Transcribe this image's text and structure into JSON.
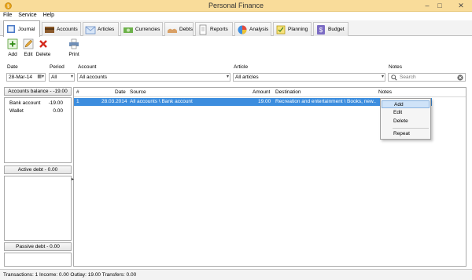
{
  "window": {
    "title": "Personal Finance",
    "minimize": "–",
    "maximize": "□",
    "close": "✕"
  },
  "menu": [
    "File",
    "Service",
    "Help"
  ],
  "tabs": [
    "Journal",
    "Accounts",
    "Articles",
    "Currencies",
    "Debts",
    "Reports",
    "Analysis",
    "Planning",
    "Budget"
  ],
  "toolbar": {
    "add": "Add",
    "edit": "Edit",
    "delete": "Delete",
    "print": "Print"
  },
  "filters": {
    "date_label": "Date",
    "date_value": "28-Mar-14",
    "period_label": "Period",
    "period_value": "All",
    "account_label": "Account",
    "account_value": "All accounts",
    "article_label": "Article",
    "article_value": "All articles",
    "notes_label": "Notes",
    "search_placeholder": "Search"
  },
  "left": {
    "accounts_balance": "Accounts balance  -  -19.00",
    "accounts": [
      {
        "name": "Bank account",
        "value": "-19.00"
      },
      {
        "name": "Wallet",
        "value": "0.00"
      }
    ],
    "active_debt": "Active debt  -  0.00",
    "passive_debt": "Passive debt  -  0.00"
  },
  "grid": {
    "columns": {
      "num": "#",
      "date": "Date",
      "source": "Source",
      "amount": "Amount",
      "destination": "Destination",
      "notes": "Notes"
    },
    "rows": [
      {
        "num": "1",
        "date": "28.03.2014",
        "source": "All accounts \\ Bank account",
        "amount": "19.00",
        "destination": "Recreation and entertainment \\ Books, new..."
      }
    ]
  },
  "context_menu": [
    "Add",
    "Edit",
    "Delete",
    "Repeat"
  ],
  "status": "Transactions: 1   Income: 0.00   Outlay: 19.00   Transfers: 0.00"
}
